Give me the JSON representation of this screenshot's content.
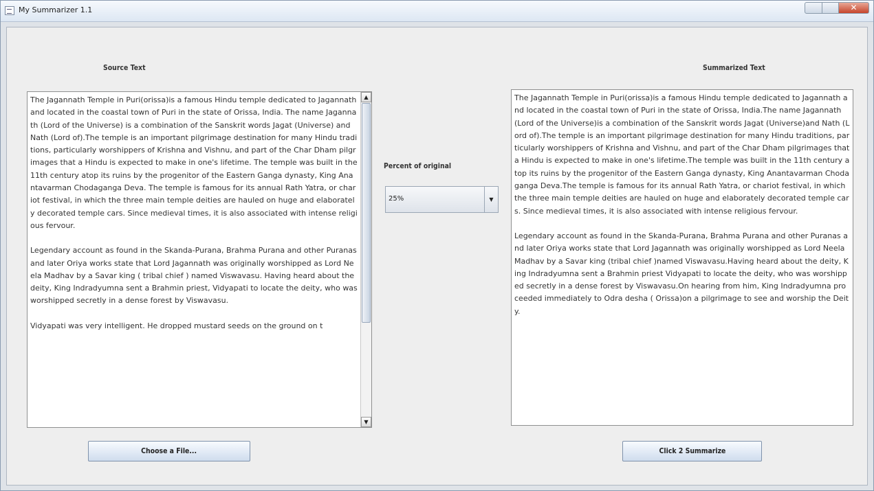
{
  "window": {
    "title": "My Summarizer 1.1"
  },
  "source": {
    "heading": "Source Text",
    "text": "The Jagannath Temple in Puri(orissa)is a famous Hindu temple dedicated to Jagannath and located in the coastal town of Puri in the state of Orissa, India. The name Jagannath (Lord of the Universe) is a combination of the Sanskrit words Jagat (Universe) and Nath (Lord of).The temple is an important pilgrimage destination for many Hindu traditions, particularly worshippers of Krishna and Vishnu, and part of the Char Dham pilgrimages that a Hindu is expected to make in one's lifetime. The temple was built in the 11th century atop its ruins by the progenitor of the Eastern Ganga dynasty, King Anantavarman Chodaganga Deva. The temple is famous for its annual Rath Yatra, or chariot festival, in which the three main temple deities are hauled on huge and elaborately decorated temple cars. Since medieval times, it is also associated with intense religious fervour.",
    "text2": "Legendary account as found in the Skanda-Purana, Brahma Purana and other Puranas and later Oriya works state that Lord Jagannath was originally worshipped as Lord Neela Madhav by a Savar king ( tribal chief ) named Viswavasu. Having heard about the deity, King Indradyumna sent a Brahmin priest, Vidyapati to locate the deity, who was worshipped secretly in a dense forest by Viswavasu.",
    "text3": "Vidyapati was very intelligent. He dropped mustard seeds on the ground on t"
  },
  "percent": {
    "label": "Percent of original",
    "value": "25%"
  },
  "summary": {
    "heading": "Summarized Text",
    "text": "The Jagannath Temple in Puri(orissa)is a famous Hindu temple dedicated to Jagannath and located in the coastal town of Puri in the state of Orissa, India.The name Jagannath (Lord of the Universe)is a combination of the Sanskrit words Jagat (Universe)and Nath (Lord of).The temple is an important pilgrimage destination for many Hindu traditions, particularly worshippers of Krishna and Vishnu, and part of the Char Dham pilgrimages that a Hindu is expected to make in one's lifetime.The temple was built in the 11th century atop its ruins by the progenitor of the Eastern Ganga dynasty, King Anantavarman Chodaganga Deva.The temple is famous for its annual Rath Yatra, or chariot festival, in which the three main temple deities are hauled on huge and elaborately decorated temple cars. Since medieval times, it is also associated with intense religious fervour.",
    "text2": "Legendary account as found in the Skanda-Purana, Brahma Purana and other Puranas and later Oriya works state that Lord Jagannath was originally worshipped as Lord Neela Madhav by a Savar king (tribal chief )named Viswavasu.Having heard about the deity, King Indradyumna sent a Brahmin priest Vidyapati to locate the deity, who was worshipped secretly in a dense forest by Viswavasu.On hearing from him, King Indradyumna proceeded immediately to Odra desha ( Orissa)on a pilgrimage to see and worship the Deity."
  },
  "buttons": {
    "choose": "Choose a File...",
    "summarize": "Click 2 Summarize"
  },
  "icons": {
    "app": "window-app-icon",
    "minimize": "minimize-icon",
    "maximize": "maximize-icon",
    "close": "close-icon",
    "dropdown": "chevron-down-icon",
    "scroll_up": "arrow-up-icon",
    "scroll_down": "arrow-down-icon"
  }
}
